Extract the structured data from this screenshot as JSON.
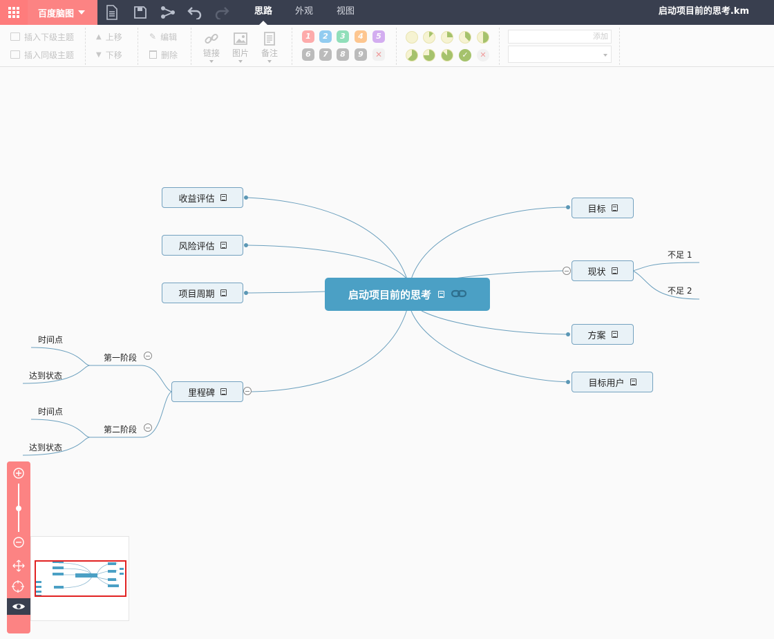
{
  "topbar": {
    "brand": "百度脑图",
    "tabs": [
      "思路",
      "外观",
      "视图"
    ],
    "active_tab": "思路",
    "filename": "启动项目前的思考.km"
  },
  "ribbon": {
    "insert_child": "插入下级主题",
    "insert_sibling": "插入同级主题",
    "move_up": "上移",
    "move_down": "下移",
    "edit": "编辑",
    "delete": "删除",
    "link": "链接",
    "image": "图片",
    "note": "备注",
    "priorities": [
      "1",
      "2",
      "3",
      "4",
      "5",
      "6",
      "7",
      "8",
      "9"
    ],
    "priority_colors": [
      "#ff6b6b",
      "#3da6e8",
      "#3bc986",
      "#ff9b3a",
      "#b36ee8",
      "#888888",
      "#888888",
      "#888888",
      "#888888"
    ],
    "resource_placeholder": "添加"
  },
  "mindmap": {
    "root": "启动项目前的思考",
    "left": [
      "收益评估",
      "风险评估",
      "项目周期",
      "里程碑"
    ],
    "right": [
      "目标",
      "现状",
      "方案",
      "目标用户"
    ],
    "status_children": [
      "不足 1",
      "不足 2"
    ],
    "milestone_children": [
      "第一阶段",
      "第二阶段"
    ],
    "phase1_children": [
      "时间点",
      "达到状态"
    ],
    "phase2_children": [
      "时间点",
      "达到状态"
    ]
  },
  "colors": {
    "topbar": "#393f4f",
    "accent": "#fc8383",
    "root_fill": "#4ba0c5",
    "node_fill": "#e9f2f7",
    "link": "#5b97b5"
  }
}
